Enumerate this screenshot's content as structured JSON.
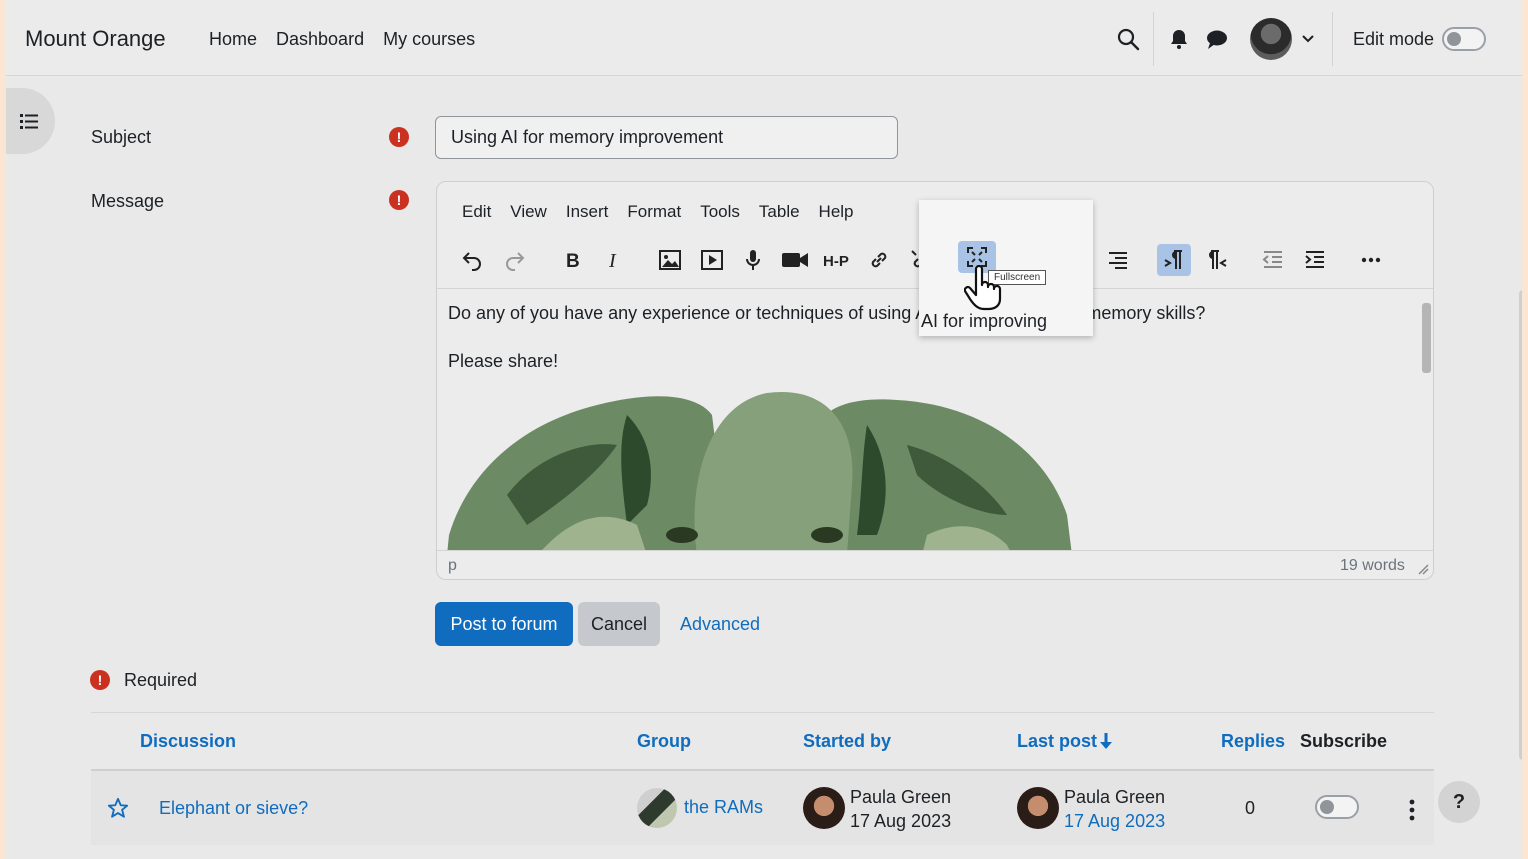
{
  "navbar": {
    "brand": "Mount Orange",
    "links": [
      "Home",
      "Dashboard",
      "My courses"
    ],
    "edit_mode_label": "Edit mode",
    "edit_mode_on": false
  },
  "form": {
    "subject_label": "Subject",
    "subject_value": "Using AI for memory improvement",
    "message_label": "Message",
    "required_text": "Required"
  },
  "editor": {
    "menu": [
      "Edit",
      "View",
      "Insert",
      "Format",
      "Tools",
      "Table",
      "Help"
    ],
    "toolbar_icons": [
      "undo-icon",
      "redo-icon",
      "bold-icon",
      "italic-icon",
      "image-icon",
      "media-icon",
      "record-audio-icon",
      "record-video-icon",
      "h5p-icon",
      "link-icon",
      "unlink-icon",
      "fullscreen-icon",
      "align-left-icon",
      "align-center-icon",
      "align-right-icon",
      "ltr-icon",
      "rtl-icon",
      "outdent-icon",
      "indent-icon",
      "more-icon"
    ],
    "tooltip": "Fullscreen",
    "content_line1": "Do any of you have any experience or techniques of using AI for improving your memory skills?",
    "content_line2": "Please share!",
    "status_path": "p",
    "word_count": "19 words"
  },
  "buttons": {
    "post": "Post to forum",
    "cancel": "Cancel",
    "advanced": "Advanced"
  },
  "table": {
    "headers": {
      "discussion": "Discussion",
      "group": "Group",
      "started_by": "Started by",
      "last_post": "Last post",
      "replies": "Replies",
      "subscribe": "Subscribe"
    },
    "rows": [
      {
        "discussion": "Elephant or sieve?",
        "group": "the RAMs",
        "started_by_name": "Paula Green",
        "started_by_date": "17 Aug 2023",
        "last_post_name": "Paula Green",
        "last_post_date": "17 Aug 2023",
        "replies": "0",
        "subscribed": false
      }
    ]
  },
  "help": "?",
  "colors": {
    "primary": "#0f6cbf",
    "required": "#ca3120",
    "toolbar_active": "#a9c3e6"
  }
}
